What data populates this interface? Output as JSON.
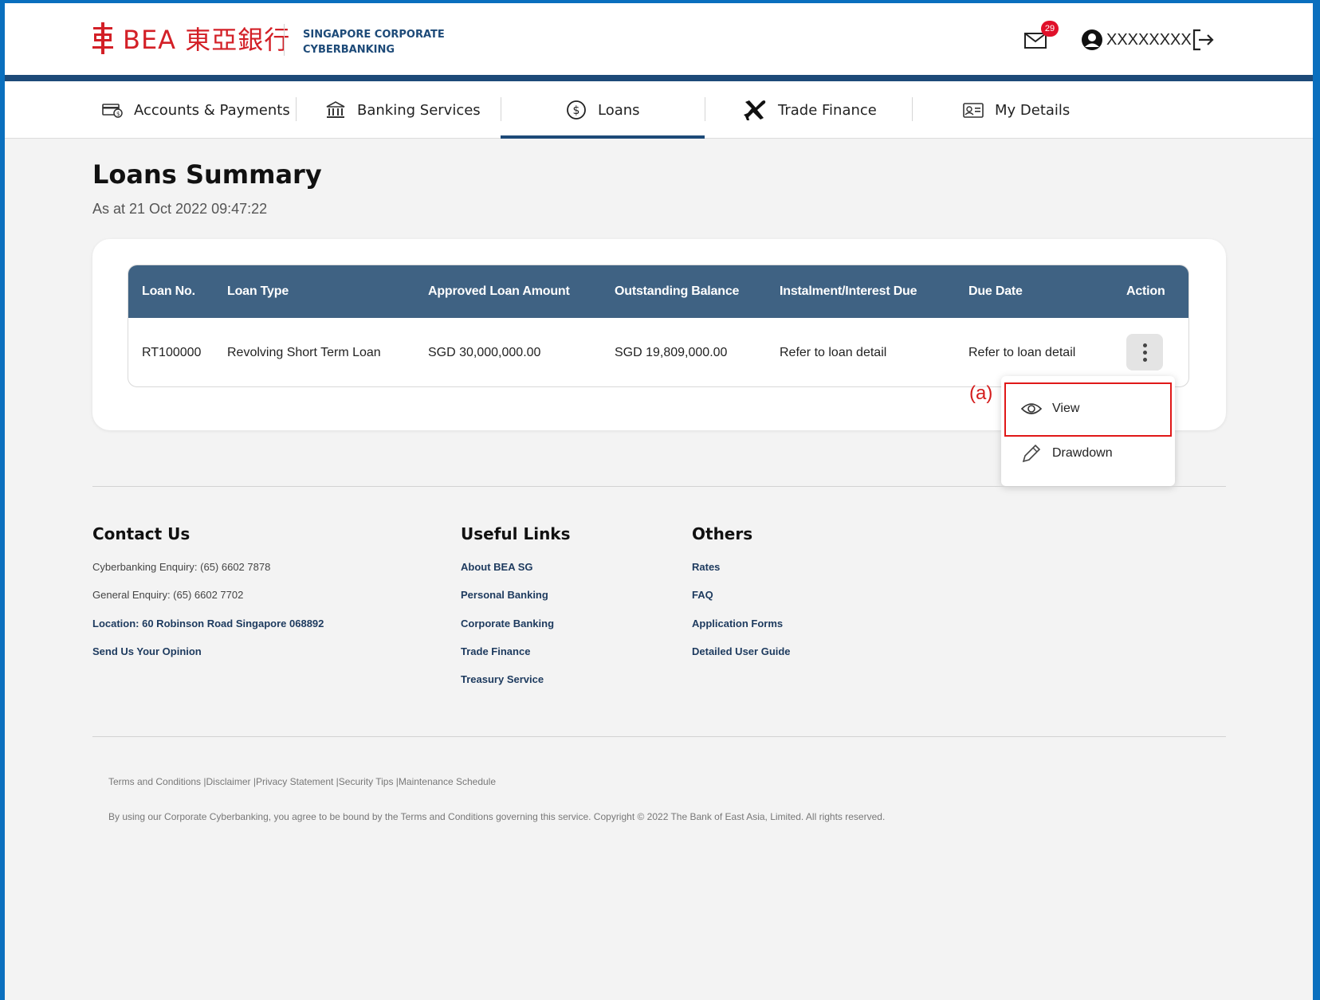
{
  "header": {
    "brand": "BEA 東亞銀行",
    "sub_line1": "SINGAPORE CORPORATE",
    "sub_line2": "CYBERBANKING",
    "mail_count": "29",
    "username": "XXXXXXXX",
    "brand_color": "#d32027",
    "accent_color": "#1d4a78"
  },
  "nav": {
    "items": [
      {
        "label": "Accounts & Payments",
        "icon": "card-cash-icon"
      },
      {
        "label": "Banking Services",
        "icon": "bank-building-icon"
      },
      {
        "label": "Loans",
        "icon": "dollar-circle-icon",
        "active": true
      },
      {
        "label": "Trade Finance",
        "icon": "airplane-icon"
      },
      {
        "label": "My Details",
        "icon": "id-card-icon"
      }
    ]
  },
  "main": {
    "title": "Loans Summary",
    "as_at": "As at 21 Oct 2022 09:47:22",
    "table": {
      "headers": [
        "Loan No.",
        "Loan Type",
        "Approved Loan Amount",
        "Outstanding Balance",
        "Instalment/Interest Due",
        "Due Date",
        "Action"
      ],
      "rows": [
        [
          "RT100000",
          "Revolving Short Term Loan",
          "SGD 30,000,000.00",
          "SGD 19,809,000.00",
          "Refer to loan detail",
          "Refer to loan detail"
        ]
      ]
    },
    "action_menu": {
      "view": "View",
      "drawdown": "Drawdown"
    },
    "annotation": "(a)"
  },
  "footer": {
    "contact": {
      "title": "Contact Us",
      "items": [
        "Cyberbanking Enquiry: (65) 6602 7878",
        "General Enquiry: (65) 6602 7702",
        "Location: 60 Robinson Road Singapore 068892",
        "Send Us Your Opinion"
      ]
    },
    "useful": {
      "title": "Useful Links",
      "items": [
        "About BEA SG",
        "Personal Banking",
        "Corporate Banking",
        "Trade Finance",
        "Treasury Service"
      ]
    },
    "others": {
      "title": "Others",
      "items": [
        "Rates",
        "FAQ",
        "Application Forms",
        "Detailed User Guide"
      ]
    },
    "legal": "Terms and Conditions |Disclaimer |Privacy Statement |Security Tips |Maintenance Schedule",
    "copyright": "By using our Corporate Cyberbanking, you agree to be bound by the Terms and Conditions governing this service. Copyright © 2022 The Bank of East Asia, Limited. All rights reserved."
  }
}
